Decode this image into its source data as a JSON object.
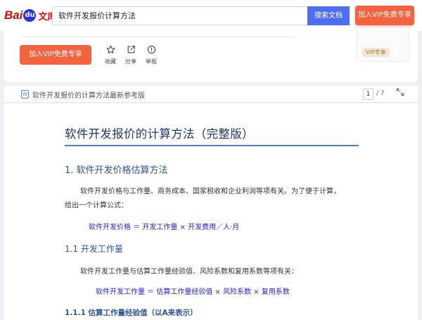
{
  "header": {
    "logo_bai": "Bai",
    "logo_du": "du",
    "logo_wenku": "文库",
    "search_value": "软件开发报价计算方法",
    "search_button": "搜索文档",
    "vip_button": "加入VIP免费专享"
  },
  "actions": {
    "vip_join": "加入VIP免费专享",
    "favorite": "收藏",
    "share": "分享",
    "report": "举报",
    "vip_badge": "VIP专享"
  },
  "doc_header": {
    "icon_letter": "W",
    "title": "软件开发报价的计算方法最新参考版",
    "page_current": "1",
    "page_total": "/ 7"
  },
  "document": {
    "title": "软件开发报价的计算方法（完整版）",
    "section1": "1. 软件开发价格估算方法",
    "para1_line1": "软件开发价格与工作量、商务成本、国家税收和企业利润等项有关。为了便于计算，",
    "para1_line2": "给出一个计算公式：",
    "formula1": "软件开发价格 ＝ 开发工作量 × 开发费用／人·月",
    "section1_1": "1.1 开发工作量",
    "para2": "软件开发工作量与估算工作量经验值、风险系数和复用系数等项有关：",
    "formula2": "软件开发工作量 ＝ 估算工作量经验值 × 风险系数 × 复用系数",
    "section1_1_1": "1.1.1 估算工作量经验值（以A来表示）"
  },
  "icons": {
    "favorite": "star-icon",
    "share": "share-icon",
    "report": "alert-circle-icon",
    "expand": "expand-icon",
    "doc": "word-doc-icon"
  },
  "colors": {
    "brand_red": "#e10602",
    "search_blue": "#4e6ef2",
    "vip_orange": "#f3633f",
    "heading_blue": "#2f5496",
    "formula_blue": "#1f1fd6"
  }
}
